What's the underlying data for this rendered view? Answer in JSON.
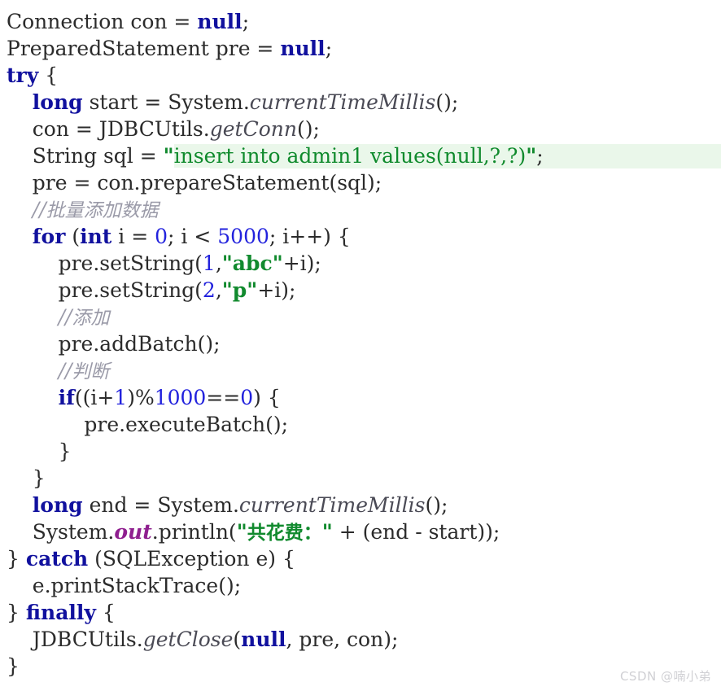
{
  "editor": {
    "language": "Java",
    "background": "#ffffff",
    "highlight_background": "#eaf7ea",
    "colors": {
      "plain": "#2b2b2b",
      "keyword": "#11119e",
      "number": "#2222dd",
      "string": "#118a2e",
      "comment": "#9a9aa8",
      "method": "#4a4a55",
      "field": "#8f1f8f"
    },
    "lines": [
      {
        "indent": 0,
        "tokens": [
          {
            "k": "plain",
            "t": "Connection con = "
          },
          {
            "k": "keyword",
            "t": "null"
          },
          {
            "k": "plain",
            "t": ";"
          }
        ]
      },
      {
        "indent": 0,
        "tokens": [
          {
            "k": "plain",
            "t": "PreparedStatement pre = "
          },
          {
            "k": "keyword",
            "t": "null"
          },
          {
            "k": "plain",
            "t": ";"
          }
        ]
      },
      {
        "indent": 0,
        "tokens": [
          {
            "k": "keyword",
            "t": "try"
          },
          {
            "k": "plain",
            "t": " {"
          }
        ]
      },
      {
        "indent": 1,
        "tokens": [
          {
            "k": "keyword",
            "t": "long"
          },
          {
            "k": "plain",
            "t": " start = System."
          },
          {
            "k": "method",
            "t": "currentTimeMillis"
          },
          {
            "k": "plain",
            "t": "();"
          }
        ]
      },
      {
        "indent": 1,
        "tokens": [
          {
            "k": "plain",
            "t": "con = JDBCUtils."
          },
          {
            "k": "method",
            "t": "getConn"
          },
          {
            "k": "plain",
            "t": "();"
          }
        ]
      },
      {
        "indent": 1,
        "highlight": true,
        "tokens": [
          {
            "k": "plain",
            "t": "String sql = "
          },
          {
            "k": "string",
            "t": "\""
          },
          {
            "k": "string-hl",
            "t": "insert into admin1 values(null,?,?)"
          },
          {
            "k": "string",
            "t": "\""
          },
          {
            "k": "plain",
            "t": ";"
          }
        ]
      },
      {
        "indent": 1,
        "tokens": [
          {
            "k": "plain",
            "t": "pre = con.prepareStatement(sql);"
          }
        ]
      },
      {
        "indent": 1,
        "tokens": [
          {
            "k": "comment",
            "t": "//"
          },
          {
            "k": "cjk-comment",
            "t": "批量添加数据"
          }
        ]
      },
      {
        "indent": 1,
        "tokens": [
          {
            "k": "keyword",
            "t": "for"
          },
          {
            "k": "plain",
            "t": " ("
          },
          {
            "k": "keyword",
            "t": "int"
          },
          {
            "k": "plain",
            "t": " i = "
          },
          {
            "k": "number",
            "t": "0"
          },
          {
            "k": "plain",
            "t": "; i < "
          },
          {
            "k": "number",
            "t": "5000"
          },
          {
            "k": "plain",
            "t": "; i++) {"
          }
        ]
      },
      {
        "indent": 2,
        "tokens": [
          {
            "k": "plain",
            "t": "pre.setString("
          },
          {
            "k": "number",
            "t": "1"
          },
          {
            "k": "plain",
            "t": ","
          },
          {
            "k": "string",
            "t": "\"abc\""
          },
          {
            "k": "plain",
            "t": "+i);"
          }
        ]
      },
      {
        "indent": 2,
        "tokens": [
          {
            "k": "plain",
            "t": "pre.setString("
          },
          {
            "k": "number",
            "t": "2"
          },
          {
            "k": "plain",
            "t": ","
          },
          {
            "k": "string",
            "t": "\"p\""
          },
          {
            "k": "plain",
            "t": "+i);"
          }
        ]
      },
      {
        "indent": 2,
        "tokens": [
          {
            "k": "comment",
            "t": "//"
          },
          {
            "k": "cjk-comment",
            "t": "添加"
          }
        ]
      },
      {
        "indent": 2,
        "tokens": [
          {
            "k": "plain",
            "t": "pre.addBatch();"
          }
        ]
      },
      {
        "indent": 2,
        "tokens": [
          {
            "k": "comment",
            "t": "//"
          },
          {
            "k": "cjk-comment",
            "t": "判断"
          }
        ]
      },
      {
        "indent": 2,
        "tokens": [
          {
            "k": "keyword",
            "t": "if"
          },
          {
            "k": "plain",
            "t": "((i+"
          },
          {
            "k": "number",
            "t": "1"
          },
          {
            "k": "plain",
            "t": ")%"
          },
          {
            "k": "number",
            "t": "1000"
          },
          {
            "k": "plain",
            "t": "=="
          },
          {
            "k": "number",
            "t": "0"
          },
          {
            "k": "plain",
            "t": ") {"
          }
        ]
      },
      {
        "indent": 3,
        "tokens": [
          {
            "k": "plain",
            "t": "pre.executeBatch();"
          }
        ]
      },
      {
        "indent": 2,
        "tokens": [
          {
            "k": "plain",
            "t": "}"
          }
        ]
      },
      {
        "indent": 1,
        "tokens": [
          {
            "k": "plain",
            "t": "}"
          }
        ]
      },
      {
        "indent": 1,
        "tokens": [
          {
            "k": "keyword",
            "t": "long"
          },
          {
            "k": "plain",
            "t": " end = System."
          },
          {
            "k": "method",
            "t": "currentTimeMillis"
          },
          {
            "k": "plain",
            "t": "();"
          }
        ]
      },
      {
        "indent": 1,
        "tokens": [
          {
            "k": "plain",
            "t": "System."
          },
          {
            "k": "field",
            "t": "out"
          },
          {
            "k": "plain",
            "t": ".println("
          },
          {
            "k": "string",
            "t": "\""
          },
          {
            "k": "cjk-string",
            "t": "共花费："
          },
          {
            "k": "string",
            "t": "\""
          },
          {
            "k": "plain",
            "t": " + (end - start));"
          }
        ]
      },
      {
        "indent": 0,
        "tokens": [
          {
            "k": "plain",
            "t": "} "
          },
          {
            "k": "keyword",
            "t": "catch"
          },
          {
            "k": "plain",
            "t": " (SQLException e) {"
          }
        ]
      },
      {
        "indent": 1,
        "tokens": [
          {
            "k": "plain",
            "t": "e.printStackTrace();"
          }
        ]
      },
      {
        "indent": 0,
        "tokens": [
          {
            "k": "plain",
            "t": "} "
          },
          {
            "k": "keyword",
            "t": "finally"
          },
          {
            "k": "plain",
            "t": " {"
          }
        ]
      },
      {
        "indent": 1,
        "tokens": [
          {
            "k": "plain",
            "t": "JDBCUtils."
          },
          {
            "k": "method",
            "t": "getClose"
          },
          {
            "k": "plain",
            "t": "("
          },
          {
            "k": "keyword",
            "t": "null"
          },
          {
            "k": "plain",
            "t": ", pre, con);"
          }
        ]
      },
      {
        "indent": 0,
        "tokens": [
          {
            "k": "plain",
            "t": "}"
          }
        ]
      }
    ]
  },
  "watermark": {
    "text": "CSDN @喃小弟"
  }
}
